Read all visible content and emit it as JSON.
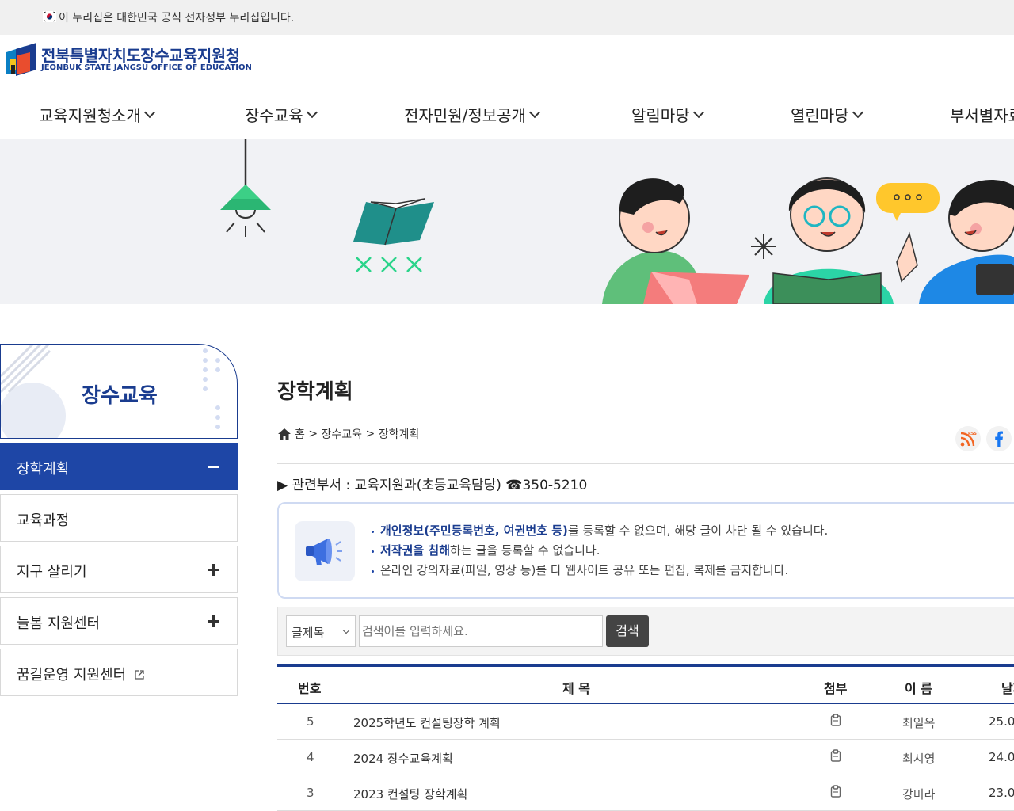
{
  "gov_bar": {
    "text": "이 누리집은 대한민국 공식 전자정부 누리집입니다."
  },
  "logo": {
    "name_ko": "전북특별자치도장수교육지원청",
    "name_en": "JEONBUK STATE JANGSU OFFICE OF EDUCATION"
  },
  "gnb": [
    "교육지원청소개",
    "장수교육",
    "전자민원/정보공개",
    "알림마당",
    "열린마당",
    "부서별자료"
  ],
  "lnb": {
    "title": "장수교육",
    "items": [
      {
        "label": "장학계획",
        "state": "expanded"
      },
      {
        "label": "교육과정",
        "state": "none"
      },
      {
        "label": "지구 살리기",
        "state": "collapsed"
      },
      {
        "label": "늘봄 지원센터",
        "state": "collapsed"
      },
      {
        "label": "꿈길운영 지원센터",
        "state": "external"
      }
    ]
  },
  "page": {
    "title": "장학계획",
    "breadcrumb": [
      "홈",
      "장수교육",
      "장학계획"
    ],
    "dept": "▶ 관련부서 : 교육지원과(초등교육담당) ☎350-5210"
  },
  "notice": {
    "line1_bold": "개인정보(주민등록번호, 여권번호 등)",
    "line1_rest": "를 등록할 수 없으며, 해당 글이 차단 될 수 있습니다.",
    "line2_bold": "저작권을 침해",
    "line2_rest": "하는 글을 등록할 수 없습니다.",
    "line3": "온라인 강의자료(파일, 영상 등)를 타 웹사이트 공유 또는 편집, 복제를 금지합니다."
  },
  "search": {
    "select_value": "글제목",
    "placeholder": "검색어를 입력하세요.",
    "button": "검색"
  },
  "table": {
    "headers": {
      "num": "번호",
      "title": "제 목",
      "attach": "첨부",
      "name": "이 름",
      "date": "날짜"
    },
    "rows": [
      {
        "num": "5",
        "title": "2025학년도 컨설팅장학 계획",
        "name": "최일옥",
        "date": "25.0"
      },
      {
        "num": "4",
        "title": "2024 장수교육계획",
        "name": "최시영",
        "date": "24.0"
      },
      {
        "num": "3",
        "title": "2023 컨설팅 장학계획",
        "name": "강미라",
        "date": "23.0"
      }
    ]
  },
  "colors": {
    "primary": "#1e46a6",
    "navy": "#1a3c8f"
  }
}
